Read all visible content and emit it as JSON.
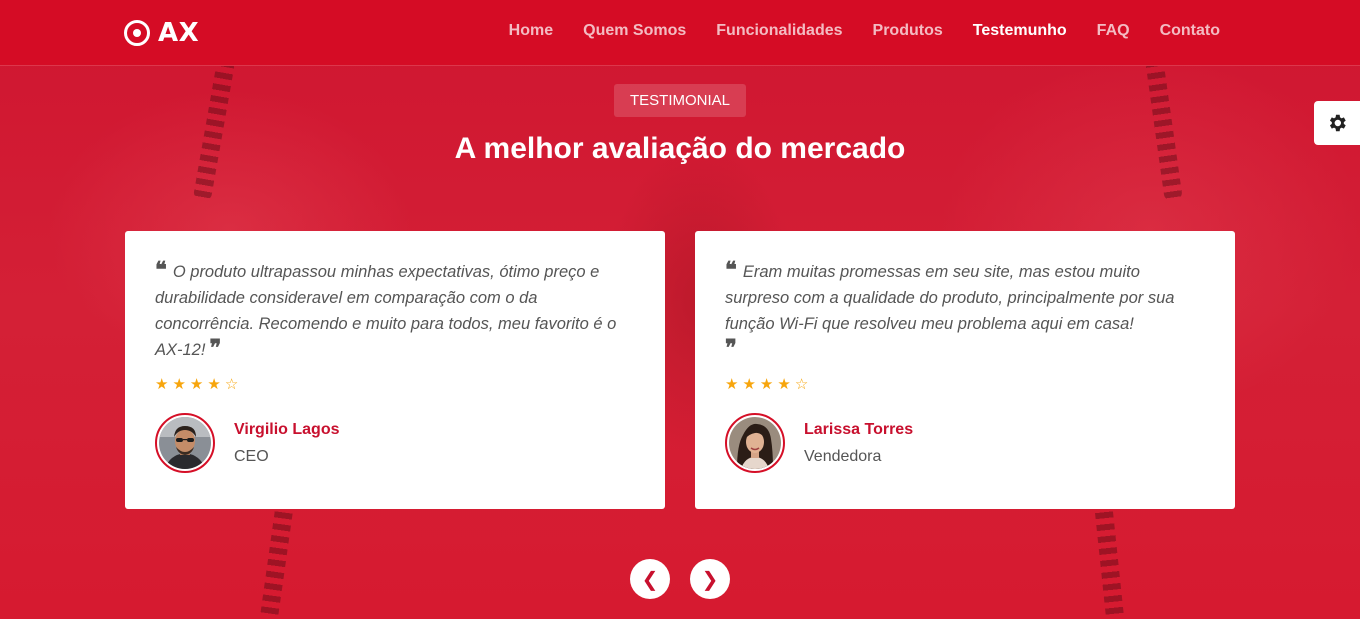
{
  "header": {
    "logo_text": "AX",
    "nav": [
      {
        "label": "Home",
        "active": false
      },
      {
        "label": "Quem Somos",
        "active": false
      },
      {
        "label": "Funcionalidades",
        "active": false
      },
      {
        "label": "Produtos",
        "active": false
      },
      {
        "label": "Testemunho",
        "active": true
      },
      {
        "label": "FAQ",
        "active": false
      },
      {
        "label": "Contato",
        "active": false
      }
    ]
  },
  "section": {
    "badge": "TESTIMONIAL",
    "title": "A melhor avaliação do mercado"
  },
  "settings": {
    "icon": "gear-icon"
  },
  "testimonials": [
    {
      "quote": "O produto ultrapassou minhas expectativas, ótimo preço e durabilidade consideravel em comparação com o da concorrência. Recomendo e muito para todos, meu favorito é o AX-12!",
      "rating": 4,
      "max_rating": 5,
      "name": "Virgilio Lagos",
      "role": "CEO"
    },
    {
      "quote": "Eram muitas promessas em seu site, mas estou muito surpreso com a qualidade do produto, principalmente por sua função Wi-Fi que resolveu meu problema aqui em casa!",
      "rating": 4,
      "max_rating": 5,
      "name": "Larissa Torres",
      "role": "Vendedora"
    }
  ],
  "carousel": {
    "prev": "❮",
    "next": "❯"
  },
  "colors": {
    "brand": "#d50f27",
    "star": "#f7a50c",
    "author_name": "#c8102e"
  }
}
